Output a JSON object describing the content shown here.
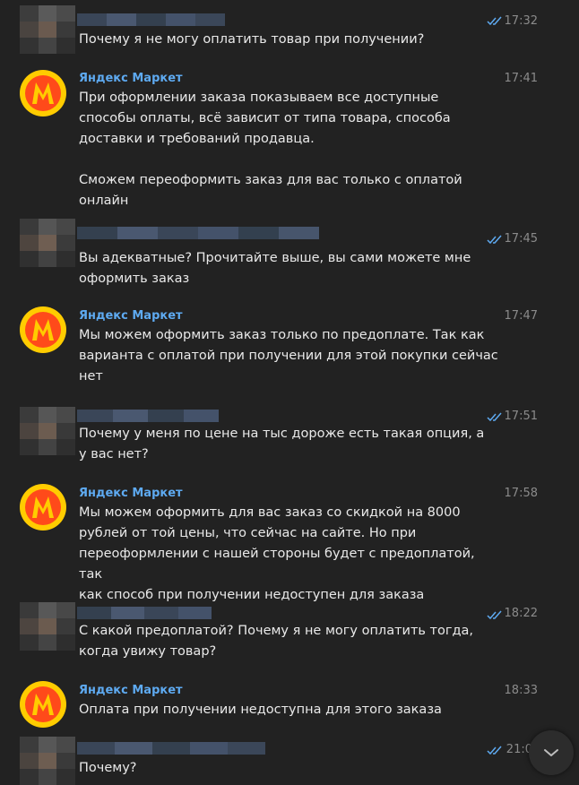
{
  "colors": {
    "background": "#222222",
    "brand_name": "#5eaaf1",
    "text": "#e9e9e9",
    "time": "#8b8b8b",
    "read_check": "#5eaaf1"
  },
  "messages": [
    {
      "sender": "user",
      "time": "17:32",
      "text": "Почему я не могу оплатить товар при получении?"
    },
    {
      "sender": "bot",
      "name": "Яндекс Маркет",
      "time": "17:41",
      "text": "При оформлении заказа показываем все доступные\nспособы оплаты, всё зависит от типа товара, способа\nдоставки и требований продавца.\n\nСможем переоформить заказ для вас только с оплатой\nонлайн"
    },
    {
      "sender": "user",
      "time": "17:45",
      "text": "Вы адекватные? Прочитайте выше, вы сами можете мне\nоформить заказ"
    },
    {
      "sender": "bot",
      "name": "Яндекс Маркет",
      "time": "17:47",
      "text": "Мы можем оформить заказ только по предоплате. Так как\nварианта с оплатой при получении для этой покупки сейчас\nнет"
    },
    {
      "sender": "user",
      "time": "17:51",
      "text": "Почему у меня по цене на тыс дороже есть такая опция, а\nу вас нет?"
    },
    {
      "sender": "bot",
      "name": "Яндекс Маркет",
      "time": "17:58",
      "text": "Мы можем оформить для вас заказ со скидкой на 8000\nрублей от той цены, что сейчас на сайте. Но при\nпереоформлении с нашей стороны будет с предоплатой, так\nкак способ при получении недоступен для заказа"
    },
    {
      "sender": "user",
      "time": "18:22",
      "text": "С какой предоплатой? Почему я не могу оплатить тогда,\nкогда увижу товар?"
    },
    {
      "sender": "bot",
      "name": "Яндекс Маркет",
      "time": "18:33",
      "text": "Оплата при получении недоступна для этого заказа"
    },
    {
      "sender": "user",
      "time": "21:0",
      "text": "Почему?"
    }
  ],
  "icons": {
    "read_check": "double-check-icon",
    "scroll_down": "chevron-down-icon",
    "brand_avatar": "yandex-market-logo"
  }
}
